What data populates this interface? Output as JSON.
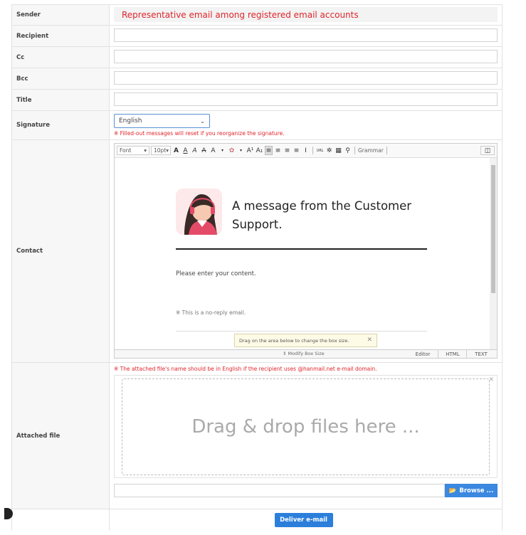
{
  "labels": {
    "sender": "Sender",
    "recipient": "Recipient",
    "cc": "Cc",
    "bcc": "Bcc",
    "title": "Title",
    "signature": "Signature",
    "contact": "Contact",
    "attached": "Attached file"
  },
  "sender_text": "Representative email among registered email accounts",
  "signature": {
    "selected": "English",
    "warning": "※ Filled-out messages will reset if you reorganize the signature."
  },
  "toolbar": {
    "font": "Font",
    "size": "10pt",
    "grammar": "Grammar"
  },
  "content": {
    "heading": "A message from the Customer Support.",
    "body": "Please enter your content.",
    "noreply": "※ This is a no-reply email.",
    "tooltip": "Drag on the area below to change the box size.",
    "modify": "Modify Box Size",
    "modes": [
      "Editor",
      "HTML",
      "TEXT"
    ]
  },
  "attach": {
    "warning": "※ The attached file's name should be in English if the recipient uses @hanmail.net e-mail domain.",
    "drop": "Drag & drop files here ...",
    "browse": "Browse ..."
  },
  "deliver": "Deliver e-mail",
  "colors": {
    "accent": "#2b7fdb",
    "warning": "#e0252c"
  },
  "icons": [
    "chevron-down-icon",
    "close-icon",
    "folder-icon",
    "avatar-icon"
  ]
}
